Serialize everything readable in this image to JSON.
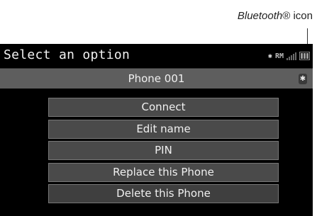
{
  "annotation": {
    "label_italic": "Bluetooth",
    "label_rest": "® icon"
  },
  "header": {
    "title": "Select an option",
    "status": {
      "bt_symbol": "✱",
      "roaming": "RM"
    }
  },
  "phone": {
    "name": "Phone 001",
    "bt_symbol": "✱"
  },
  "menu": {
    "items": [
      {
        "label": "Connect"
      },
      {
        "label": "Edit name"
      },
      {
        "label": "PIN"
      },
      {
        "label": "Replace this Phone"
      },
      {
        "label": "Delete this Phone"
      }
    ]
  }
}
